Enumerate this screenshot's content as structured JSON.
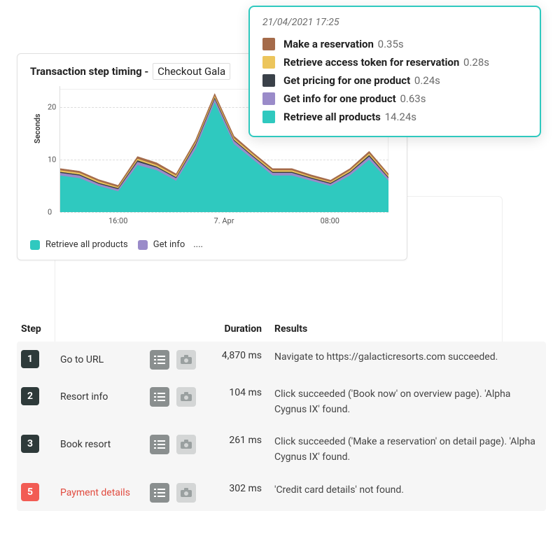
{
  "card": {
    "title_prefix": "Transaction step timing - ",
    "dropdown_label": "Checkout Gala",
    "ylabel": "Seconds"
  },
  "legend": {
    "items": [
      {
        "label": "Retrieve all products",
        "color": "#2fc9bf"
      },
      {
        "label": "Get info",
        "color": "#9a8bc9"
      }
    ],
    "ellipsis": "...."
  },
  "tooltip": {
    "timestamp": "21/04/2021 17:25",
    "rows": [
      {
        "color": "#a56b4a",
        "name": "Make a reservation",
        "value": "0.35s"
      },
      {
        "color": "#ecc55c",
        "name": "Retrieve access token for reservation",
        "value": "0.28s"
      },
      {
        "color": "#3a4149",
        "name": "Get pricing for one product",
        "value": "0.24s"
      },
      {
        "color": "#9a8bc9",
        "name": "Get info for one product",
        "value": "0.63s"
      },
      {
        "color": "#2fc9bf",
        "name": "Retrieve all products",
        "value": "14.24s"
      }
    ]
  },
  "chart_data": {
    "type": "area",
    "ylabel": "Seconds",
    "ylim": [
      0,
      24
    ],
    "yticks": [
      0,
      10,
      20
    ],
    "xticks": [
      "16:00",
      "7. Apr",
      "08:00"
    ],
    "x": [
      0,
      1,
      2,
      3,
      4,
      5,
      6,
      7,
      8,
      9,
      10,
      11,
      12,
      13,
      14,
      15,
      16,
      17
    ],
    "series": [
      {
        "name": "Retrieve all products",
        "color": "#2fc9bf",
        "values": [
          7,
          6.5,
          5,
          4,
          9,
          8,
          6,
          12,
          21,
          13,
          10,
          7,
          7,
          6,
          5,
          7,
          10,
          6
        ]
      },
      {
        "name": "Get info for one product",
        "color": "#9a8bc9",
        "values": [
          0.5,
          0.5,
          0.4,
          0.4,
          0.6,
          0.5,
          0.5,
          0.7,
          0.6,
          0.6,
          0.5,
          0.5,
          0.5,
          0.4,
          0.4,
          0.5,
          0.6,
          0.5
        ]
      },
      {
        "name": "Get pricing for one product",
        "color": "#3a4149",
        "values": [
          0.2,
          0.2,
          0.2,
          0.2,
          0.3,
          0.2,
          0.2,
          0.3,
          0.3,
          0.2,
          0.2,
          0.2,
          0.2,
          0.2,
          0.2,
          0.2,
          0.3,
          0.2
        ]
      },
      {
        "name": "Retrieve access token for reservation",
        "color": "#ecc55c",
        "values": [
          0.3,
          0.3,
          0.3,
          0.2,
          0.3,
          0.3,
          0.3,
          0.3,
          0.3,
          0.3,
          0.3,
          0.3,
          0.3,
          0.2,
          0.2,
          0.3,
          0.3,
          0.3
        ]
      },
      {
        "name": "Make a reservation",
        "color": "#a56b4a",
        "values": [
          0.3,
          0.3,
          0.3,
          0.3,
          0.4,
          0.4,
          0.3,
          0.4,
          0.4,
          0.4,
          0.3,
          0.3,
          0.3,
          0.3,
          0.3,
          0.3,
          0.4,
          0.3
        ]
      }
    ]
  },
  "table": {
    "headers": {
      "step": "Step",
      "duration": "Duration",
      "results": "Results"
    },
    "rows": [
      {
        "num": "1",
        "err": false,
        "name": "Go to URL",
        "duration": "4,870 ms",
        "result": "Navigate to https://galacticresorts.com succeeded."
      },
      {
        "num": "2",
        "err": false,
        "name": "Resort info",
        "duration": "104 ms",
        "result": "Click succeeded ('Book now' on overview page). 'Alpha Cygnus IX' found."
      },
      {
        "num": "3",
        "err": false,
        "name": "Book resort",
        "duration": "261 ms",
        "result": "Click succeeded ('Make a reservation' on detail page). 'Alpha Cygnus IX' found."
      },
      {
        "num": "5",
        "err": true,
        "name": "Payment details",
        "duration": "302 ms",
        "result": "'Credit card details' not found."
      }
    ]
  },
  "colors": {
    "accent": "#2fc9bf",
    "error": "#f25c54"
  }
}
